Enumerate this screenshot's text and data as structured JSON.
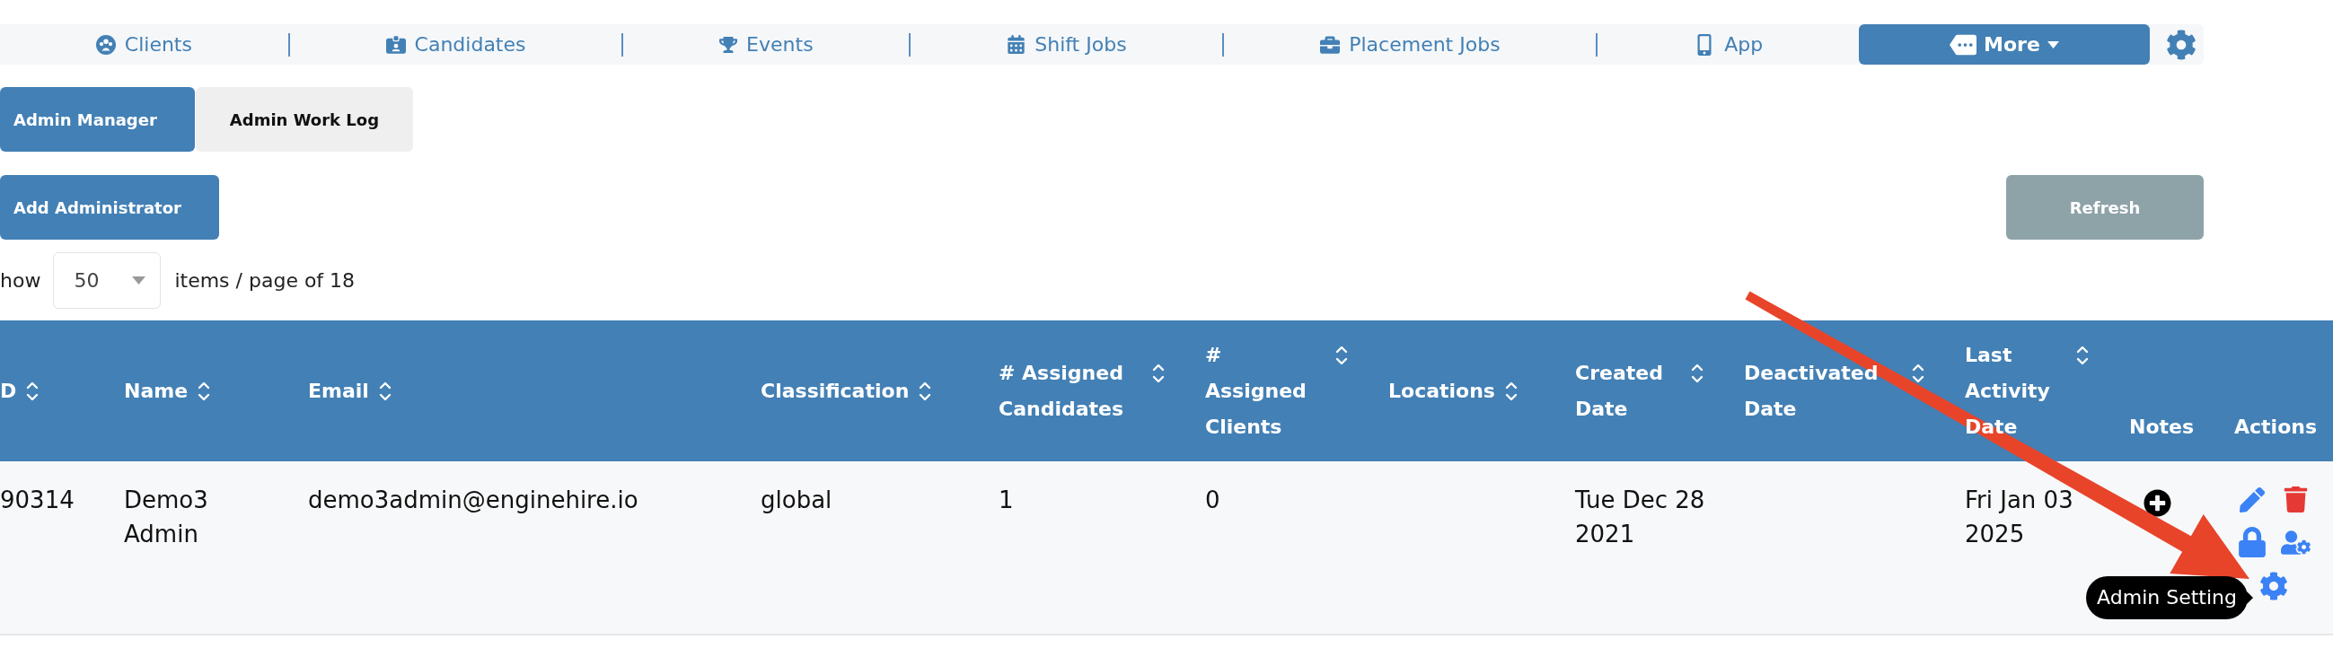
{
  "nav": {
    "items": [
      {
        "label": "Clients"
      },
      {
        "label": "Candidates"
      },
      {
        "label": "Events"
      },
      {
        "label": "Shift Jobs"
      },
      {
        "label": "Placement Jobs"
      },
      {
        "label": "App"
      }
    ],
    "more": {
      "label": "More"
    }
  },
  "tabs": [
    {
      "label": "Admin Manager",
      "selected": true
    },
    {
      "label": "Admin Work Log",
      "selected": false
    }
  ],
  "toolbar": {
    "add_button": "Add Administrator",
    "refresh_button": "Refresh"
  },
  "pagination": {
    "prefix": "how",
    "page_size": "50",
    "suffix": "items / page of 18"
  },
  "table": {
    "columns": [
      {
        "label": "D",
        "sortable": true
      },
      {
        "label": "Name",
        "sortable": true
      },
      {
        "label": "Email",
        "sortable": true
      },
      {
        "label": "Classification",
        "sortable": true
      },
      {
        "label": "# Assigned Candidates",
        "sortable": true
      },
      {
        "label": "# Assigned Clients",
        "sortable": true
      },
      {
        "label": "Locations",
        "sortable": true
      },
      {
        "label": "Created Date",
        "sortable": true
      },
      {
        "label": "Deactivated Date",
        "sortable": true
      },
      {
        "label": "Last Activity Date",
        "sortable": true
      },
      {
        "label": "Notes",
        "sortable": false
      },
      {
        "label": "Actions",
        "sortable": false
      }
    ],
    "rows": [
      {
        "column_1": "90314",
        "name": "Demo3 Admin",
        "email": "demo3admin@enginehire.io",
        "classification": "global",
        "assigned_candidates": "1",
        "assigned_clients": "0",
        "created_date": "Tue Dec 28 2021",
        "last_activity_date": "Fri Jan 03 2025",
        "tooltip": "Admin Setting"
      }
    ]
  }
}
